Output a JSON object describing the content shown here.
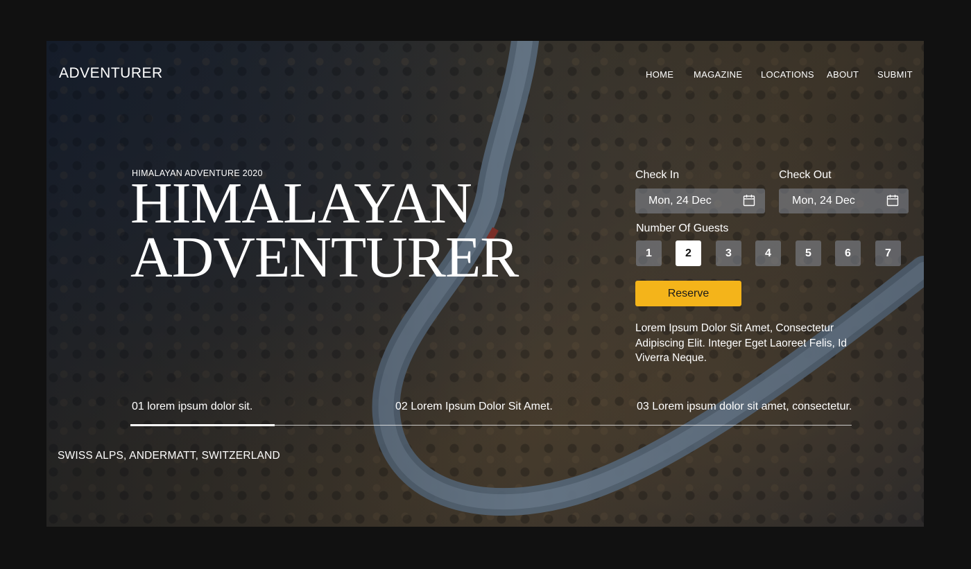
{
  "brand": "ADVENTURER",
  "nav": {
    "home": "HOME",
    "magazine": "MAGAZINE",
    "locations": "LOCATIONS",
    "about": "ABOUT",
    "submit": "SUBMIT"
  },
  "hero": {
    "eyebrow": "HIMALAYAN ADVENTURE 2020",
    "title_line1": "HIMALAYAN",
    "title_line2": "ADVENTURER"
  },
  "booking": {
    "check_in_label": "Check In",
    "check_in_value": "Mon, 24 Dec",
    "check_out_label": "Check Out",
    "check_out_value": "Mon, 24 Dec",
    "guests_label": "Number Of Guests",
    "guests": [
      "1",
      "2",
      "3",
      "4",
      "5",
      "6",
      "7"
    ],
    "selected_guests": "2",
    "reserve_label": "Reserve",
    "description": "Lorem Ipsum Dolor Sit Amet, Consectetur Adipiscing Elit. Integer Eget Laoreet Felis, Id Viverra Neque."
  },
  "slides": [
    "01 lorem ipsum dolor sit.",
    "02 Lorem Ipsum Dolor Sit Amet.",
    "03 Lorem ipsum dolor sit amet, consectetur."
  ],
  "slide_progress": 0.2,
  "location": "SWISS ALPS, ANDERMATT, SWITZERLAND",
  "colors": {
    "accent": "#f4b41a",
    "page_background": "#111111",
    "text": "#ffffff"
  },
  "icons": {
    "date_picker": "calendar-icon"
  }
}
